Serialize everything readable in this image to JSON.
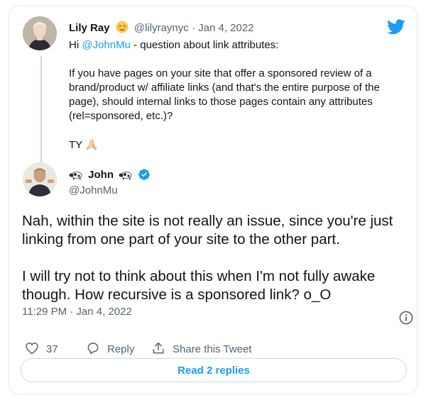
{
  "reply": {
    "name": "Lily Ray",
    "handle": "@lilyraynyc",
    "separator": "·",
    "date": "Jan 4, 2022",
    "greeting_prefix": "Hi ",
    "mention": "@JohnMu",
    "greeting_suffix": " - question about link attributes:",
    "paragraph": "If you have pages on your site that offer a sponsored review of a brand/product w/ affiliate links (and that's the entire purpose of the page), should internal links to those pages contain any attributes (rel=sponsored, etc.)?",
    "closing": "TY"
  },
  "tweet": {
    "name": "John",
    "handle": "@JohnMu",
    "verified": true,
    "text_line_1": "Nah, within the site is not really an issue, since you're just linking from one part of your site to the other part.",
    "text_line_2": "I will try not to think about this when I'm not fully awake though. How recursive is a sponsored link? o_O",
    "timestamp": "11:29 PM · Jan 4, 2022"
  },
  "actions": {
    "like_count": "37",
    "reply_label": "Reply",
    "share_label": "Share this Tweet"
  },
  "read_replies_label": "Read 2 replies",
  "colors": {
    "twitter_blue": "#1d9bf0",
    "text": "#0f1419",
    "secondary": "#536471",
    "border": "#cfd9de"
  },
  "icons": [
    "twitter-logo-icon",
    "relieved-face-emoji",
    "folded-hands-emoji",
    "cow-emoji",
    "verified-badge-icon",
    "info-icon",
    "heart-icon",
    "reply-bubble-icon",
    "share-icon"
  ]
}
